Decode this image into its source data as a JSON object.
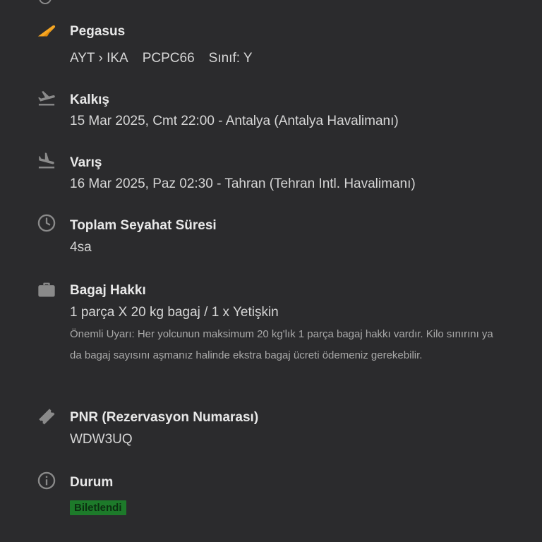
{
  "cutoff_text": "____ ____ ____",
  "airline": {
    "name": "Pegasus",
    "route": "AYT › IKA",
    "flight_code": "PCPC66",
    "class_label": "Sınıf: Y"
  },
  "departure": {
    "title": "Kalkış",
    "value": "15 Mar 2025, Cmt 22:00 - Antalya (Antalya Havalimanı)"
  },
  "arrival": {
    "title": "Varış",
    "value": "16 Mar 2025, Paz 02:30 - Tahran (Tehran Intl. Havalimanı)"
  },
  "duration": {
    "title": "Toplam Seyahat Süresi",
    "value": "4sa"
  },
  "baggage": {
    "title": "Bagaj Hakkı",
    "value": "1 parça X 20 kg bagaj / 1 x Yetişkin",
    "note": "Önemli Uyarı: Her yolcunun maksimum 20 kg'lık 1 parça bagaj hakkı vardır. Kilo sınırını ya da bagaj sayısını aşmanız halinde ekstra bagaj ücreti ödemeniz gerekebilir."
  },
  "pnr": {
    "title": "PNR (Rezervasyon Numarası)",
    "value": "WDW3UQ"
  },
  "status": {
    "title": "Durum",
    "badge": "Biletlendi",
    "badge_color": "#1d7a2a"
  },
  "icons": {
    "airline": "pegasus-logo-icon",
    "departure": "plane-takeoff-icon",
    "arrival": "plane-landing-icon",
    "duration": "clock-icon",
    "baggage": "suitcase-icon",
    "pnr": "ticket-icon",
    "status": "info-icon"
  },
  "colors": {
    "background": "#2b2b2d",
    "icon_gray": "#8a8a8a",
    "brand_orange": "#f5a623"
  }
}
